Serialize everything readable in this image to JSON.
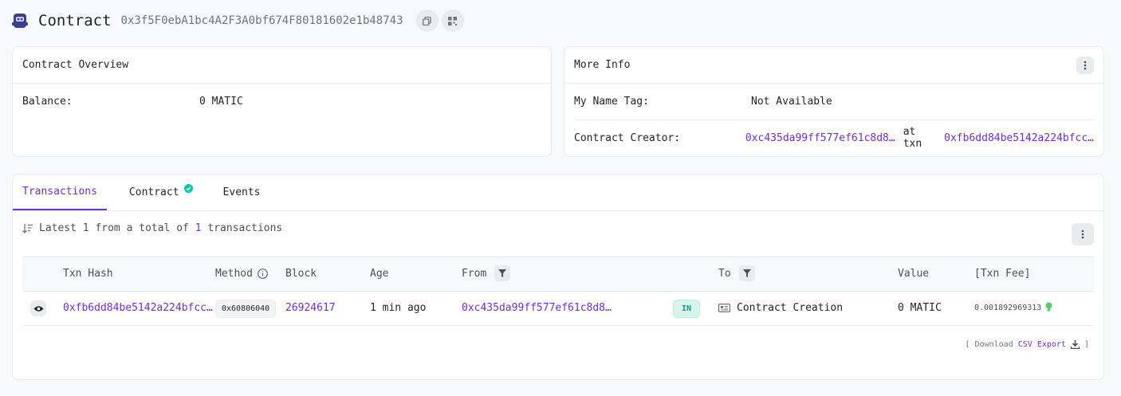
{
  "header": {
    "title": "Contract",
    "address": "0x3f5F0ebA1bc4A2F3A0bf674F80181602e1b48743",
    "icons": [
      "contract-logo-icon",
      "copy-icon",
      "qr-code-icon"
    ]
  },
  "overview": {
    "title": "Contract Overview",
    "balance_label": "Balance:",
    "balance_value": "0 MATIC"
  },
  "more_info": {
    "title": "More Info",
    "name_tag_label": "My Name Tag:",
    "name_tag_value": "Not Available",
    "creator_label": "Contract Creator:",
    "creator_address": "0xc435da99ff577ef61c8d8…",
    "at_txn": "at txn",
    "creator_txn": "0xfb6dd84be5142a224bfcc…"
  },
  "tabs": [
    {
      "label": "Transactions",
      "active": true
    },
    {
      "label": "Contract",
      "verified": true
    },
    {
      "label": "Events"
    }
  ],
  "summary": {
    "prefix": "Latest",
    "latest_count": "1",
    "middle": "from a total of",
    "total_count": "1",
    "suffix": "transactions"
  },
  "table": {
    "columns": [
      "Txn Hash",
      "Method",
      "Block",
      "Age",
      "From",
      "To",
      "Value",
      "[Txn Fee]"
    ],
    "rows": [
      {
        "txn_hash": "0xfb6dd84be5142a224bfcc…",
        "method": "0x60806040",
        "block": "26924617",
        "age": "1 min ago",
        "from": "0xc435da99ff577ef61c8d8…",
        "direction": "IN",
        "to": "Contract Creation",
        "value": "0 MATIC",
        "fee": "0.001892969313"
      }
    ]
  },
  "footer": {
    "open_bracket": "[",
    "download": "Download",
    "csv_export": "CSV Export",
    "close_bracket": "]"
  },
  "colors": {
    "accent": "#6f2dd6",
    "success": "#00a186",
    "border": "#e7eaf3"
  }
}
